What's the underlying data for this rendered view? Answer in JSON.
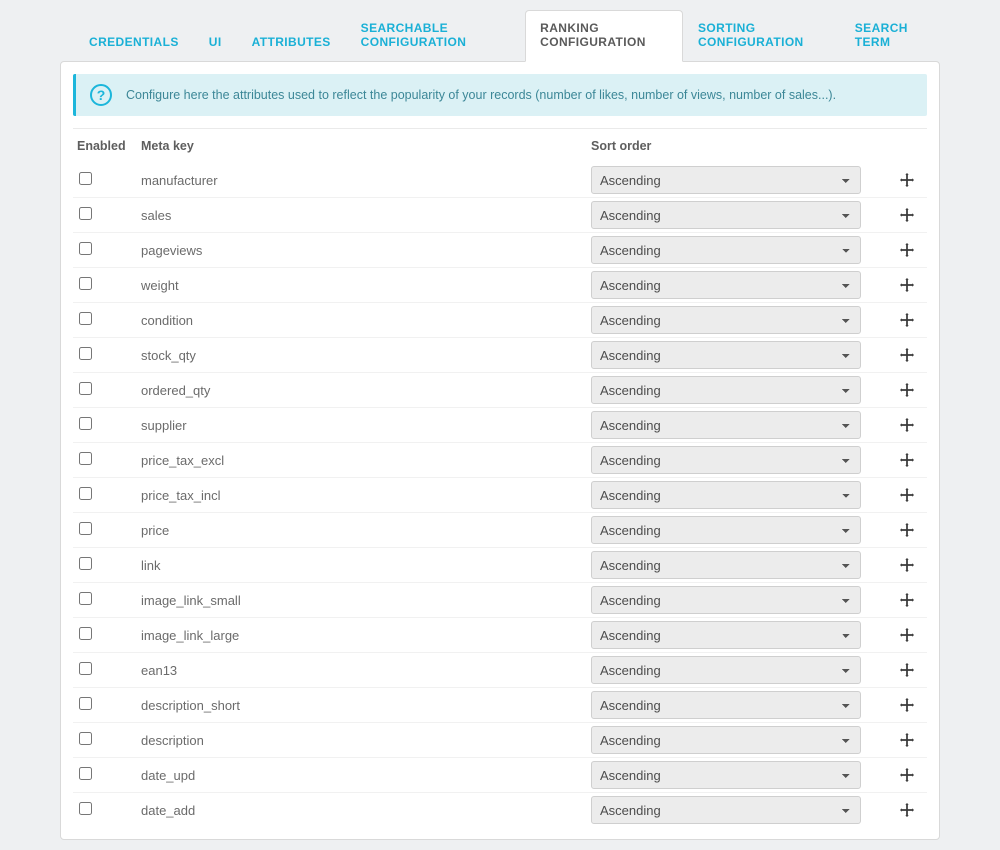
{
  "tabs": [
    {
      "label": "CREDENTIALS",
      "active": false
    },
    {
      "label": "UI",
      "active": false
    },
    {
      "label": "ATTRIBUTES",
      "active": false
    },
    {
      "label": "SEARCHABLE CONFIGURATION",
      "active": false
    },
    {
      "label": "RANKING CONFIGURATION",
      "active": true
    },
    {
      "label": "SORTING CONFIGURATION",
      "active": false
    },
    {
      "label": "SEARCH TERM",
      "active": false
    }
  ],
  "info": "Configure here the attributes used to reflect the popularity of your records (number of likes, number of views, number of sales...).",
  "columns": {
    "enabled": "Enabled",
    "meta": "Meta key",
    "sort": "Sort order"
  },
  "rows": [
    {
      "enabled": false,
      "meta": "manufacturer",
      "sort": "Ascending"
    },
    {
      "enabled": false,
      "meta": "sales",
      "sort": "Ascending"
    },
    {
      "enabled": false,
      "meta": "pageviews",
      "sort": "Ascending"
    },
    {
      "enabled": false,
      "meta": "weight",
      "sort": "Ascending"
    },
    {
      "enabled": false,
      "meta": "condition",
      "sort": "Ascending"
    },
    {
      "enabled": false,
      "meta": "stock_qty",
      "sort": "Ascending"
    },
    {
      "enabled": false,
      "meta": "ordered_qty",
      "sort": "Ascending"
    },
    {
      "enabled": false,
      "meta": "supplier",
      "sort": "Ascending"
    },
    {
      "enabled": false,
      "meta": "price_tax_excl",
      "sort": "Ascending"
    },
    {
      "enabled": false,
      "meta": "price_tax_incl",
      "sort": "Ascending"
    },
    {
      "enabled": false,
      "meta": "price",
      "sort": "Ascending"
    },
    {
      "enabled": false,
      "meta": "link",
      "sort": "Ascending"
    },
    {
      "enabled": false,
      "meta": "image_link_small",
      "sort": "Ascending"
    },
    {
      "enabled": false,
      "meta": "image_link_large",
      "sort": "Ascending"
    },
    {
      "enabled": false,
      "meta": "ean13",
      "sort": "Ascending"
    },
    {
      "enabled": false,
      "meta": "description_short",
      "sort": "Ascending"
    },
    {
      "enabled": false,
      "meta": "description",
      "sort": "Ascending"
    },
    {
      "enabled": false,
      "meta": "date_upd",
      "sort": "Ascending"
    },
    {
      "enabled": false,
      "meta": "date_add",
      "sort": "Ascending"
    }
  ]
}
